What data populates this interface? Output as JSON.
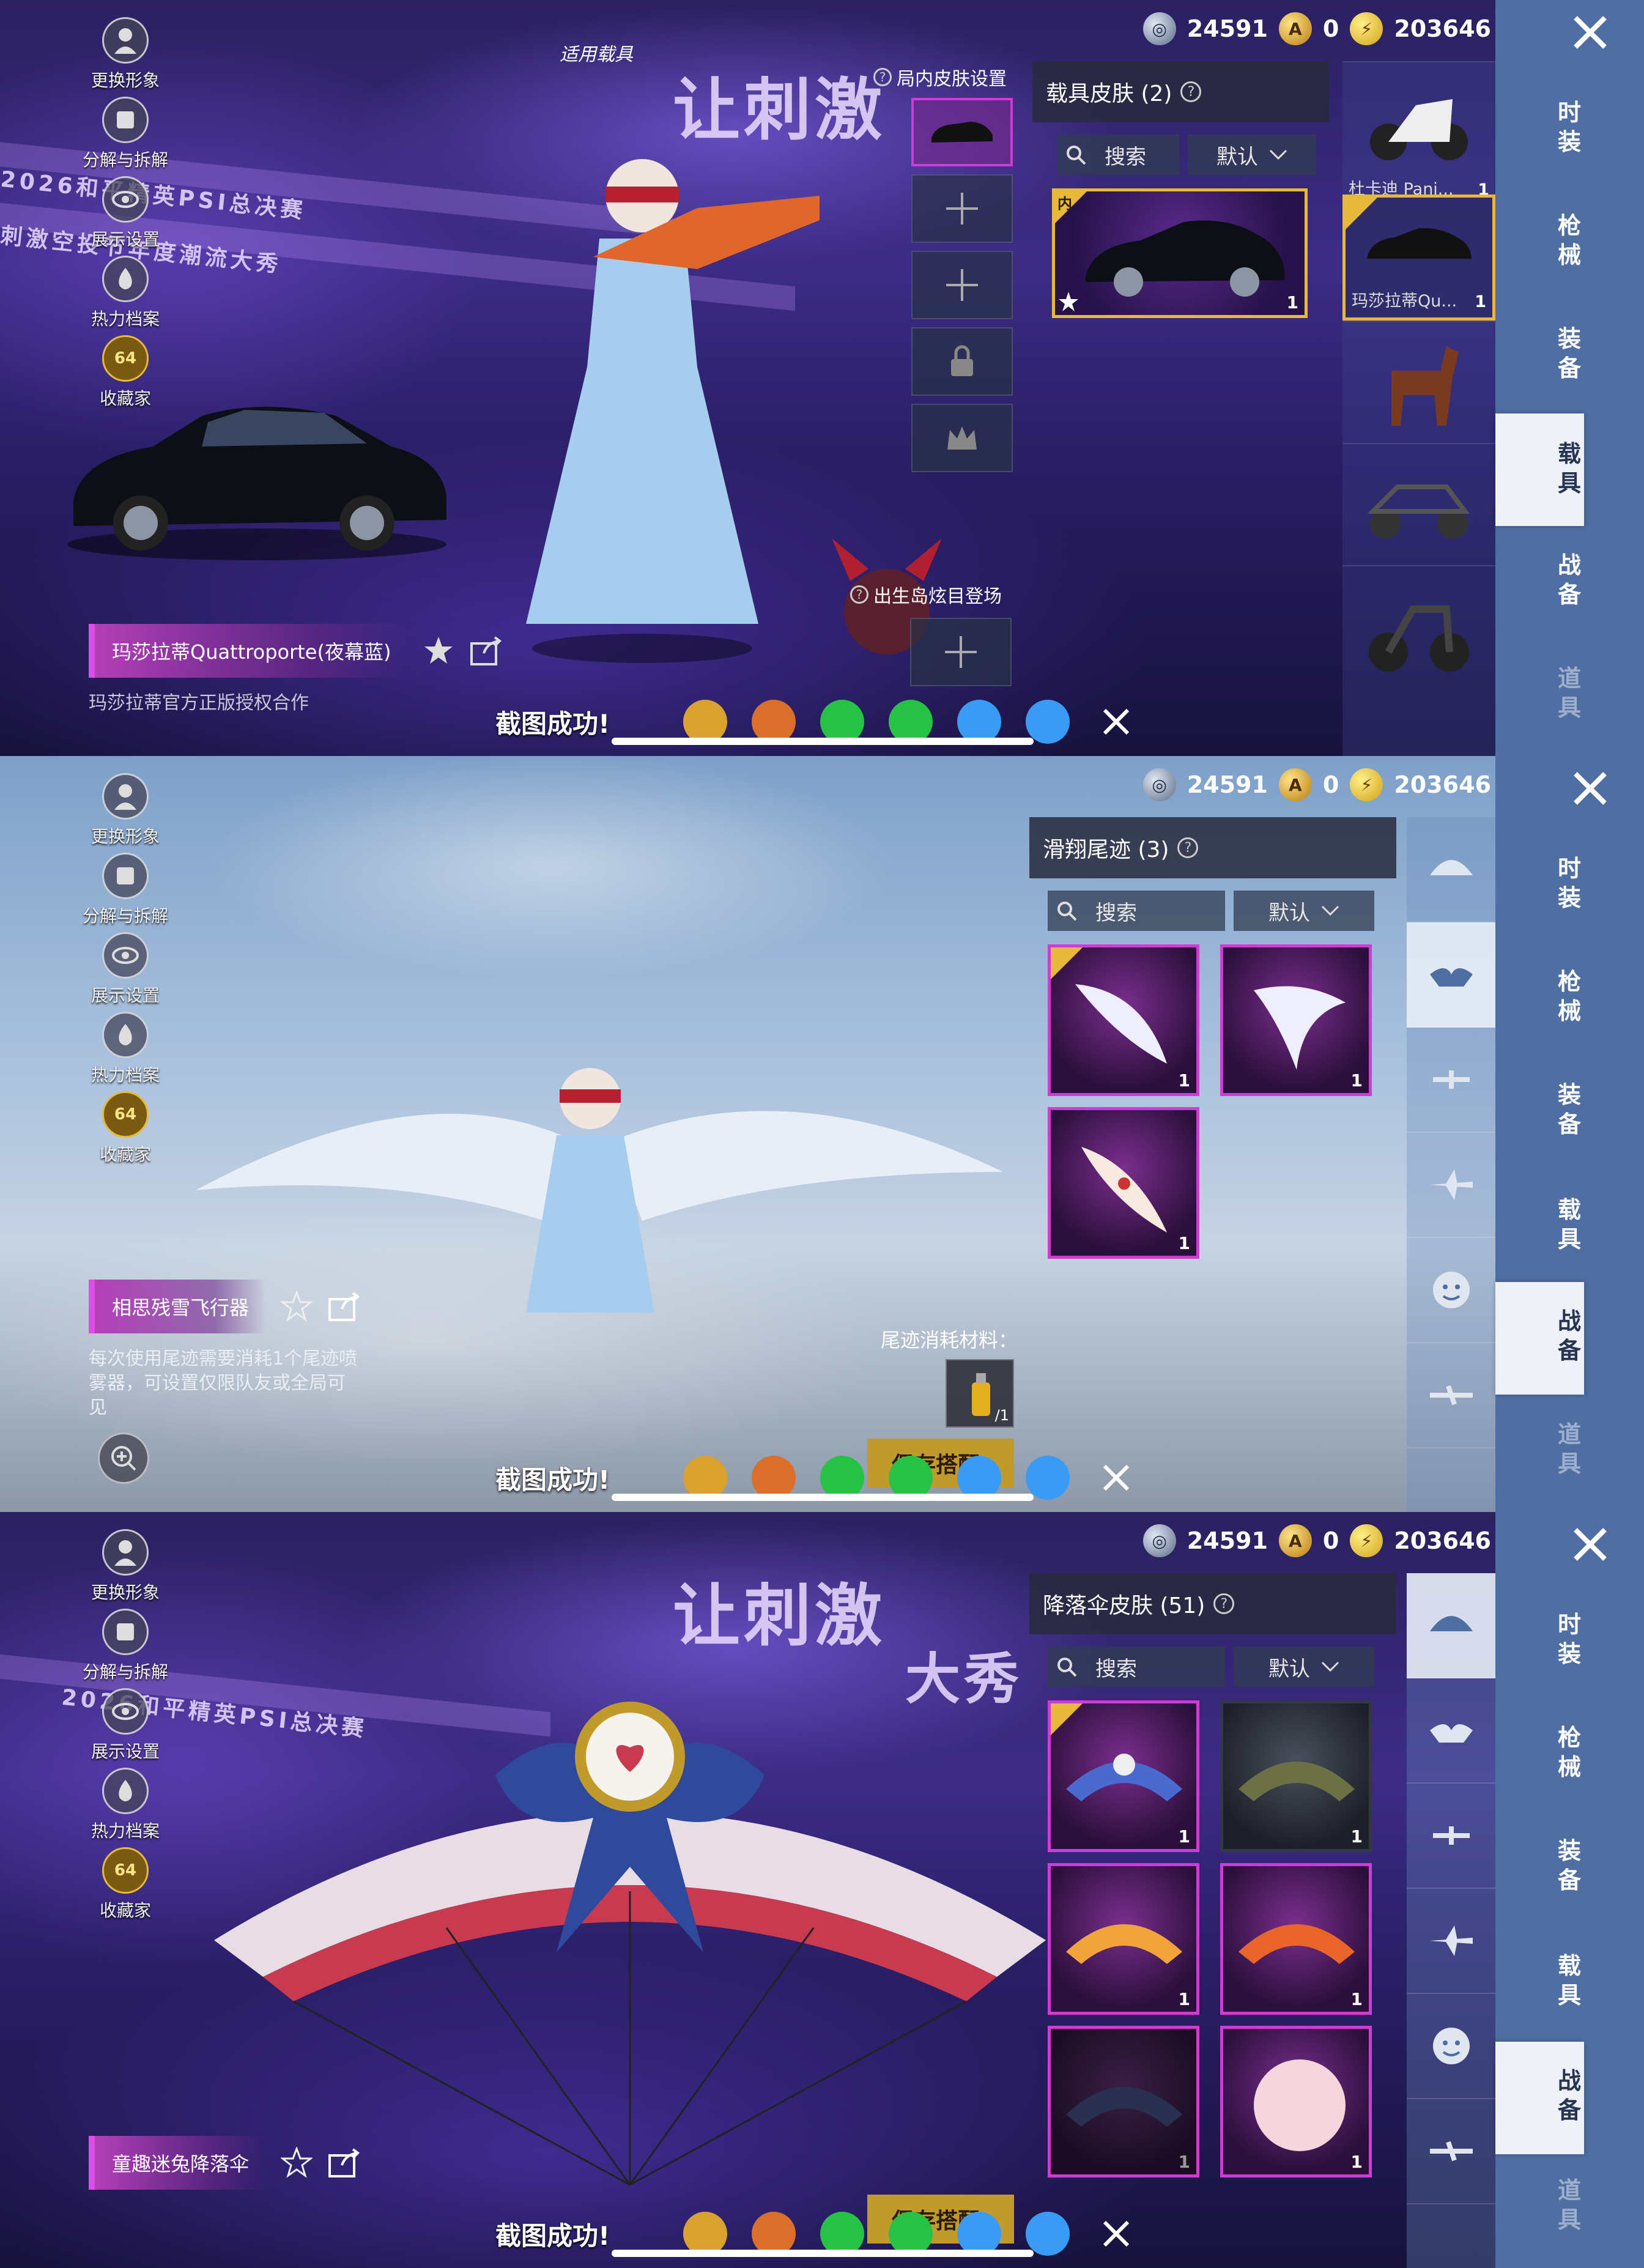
{
  "currency": {
    "silver": "24591",
    "gold": "0",
    "points": "203646"
  },
  "tabs": [
    "时装",
    "枪械",
    "装备",
    "载具",
    "战备",
    "道具"
  ],
  "left_menu": [
    "更换形象",
    "分解与拆解",
    "展示设置",
    "热力档案",
    "收藏家"
  ],
  "collector_badge": "64",
  "share": {
    "toast": "截图成功!"
  },
  "panel_vehicle": {
    "active_tab": "载具",
    "list_title": "载具皮肤 (2)",
    "search_placeholder": "搜索",
    "sort": "默认",
    "apply_label": "适用载具",
    "ingame_skin_label": "局内皮肤设置",
    "spawn_entrance_label": "出生岛炫目登场",
    "card_badge": "内",
    "card_count": "1",
    "strip": [
      {
        "label": "杜卡迪 Pani...",
        "count": "1"
      },
      {
        "label": "玛莎拉蒂Qu...",
        "count": "1"
      }
    ],
    "item_name": "玛莎拉蒂Quattroporte(夜幕蓝)",
    "item_desc": "玛莎拉蒂官方正版授权合作",
    "banner_top": "让刺激",
    "banner_mid": "2026和平精英PSI总决赛",
    "banner_lower": "刺激空投节年度潮流大秀"
  },
  "panel_trail": {
    "active_tab": "战备",
    "list_title": "滑翔尾迹 (3)",
    "search_placeholder": "搜索",
    "sort": "默认",
    "cards": [
      "1",
      "1",
      "1"
    ],
    "item_name": "相思残雪飞行器",
    "item_desc": "每次使用尾迹需要消耗1个尾迹喷雾器，可设置仅限队友或全局可见",
    "material_label": "尾迹消耗材料：",
    "material_count": "/1",
    "save_label": "保存搭配"
  },
  "panel_parachute": {
    "active_tab": "战备",
    "list_title": "降落伞皮肤 (51)",
    "search_placeholder": "搜索",
    "sort": "默认",
    "cards": [
      "1",
      "1",
      "1",
      "1",
      "1",
      "1"
    ],
    "item_name": "童趣迷兔降落伞",
    "save_label": "保存搭配",
    "banner_top": "让刺激",
    "banner_right": "大秀",
    "banner_mid": "2026和平精英PSI总决赛"
  },
  "colors": {
    "tab_bg": "#4f6ea3",
    "accent_pink": "#d03ad5",
    "accent_gold": "#e7b93b"
  }
}
